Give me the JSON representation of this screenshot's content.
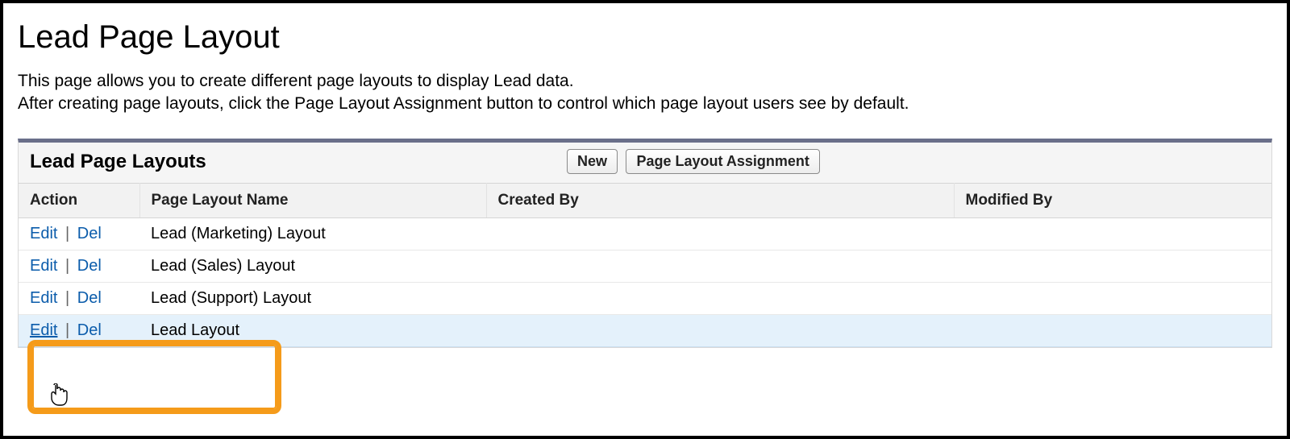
{
  "page": {
    "title": "Lead Page Layout",
    "description_line1": "This page allows you to create different page layouts to display Lead data.",
    "description_line2": "After creating page layouts, click the Page Layout Assignment button to control which page layout users see by default."
  },
  "panel": {
    "title": "Lead Page Layouts",
    "buttons": {
      "new": "New",
      "assignment": "Page Layout Assignment"
    }
  },
  "table": {
    "columns": {
      "action": "Action",
      "name": "Page Layout Name",
      "created_by": "Created By",
      "modified_by": "Modified By"
    },
    "action_labels": {
      "edit": "Edit",
      "del": "Del",
      "sep": "|"
    },
    "rows": [
      {
        "name": "Lead (Marketing) Layout",
        "created_by": "",
        "modified_by": "",
        "hover": false
      },
      {
        "name": "Lead (Sales) Layout",
        "created_by": "",
        "modified_by": "",
        "hover": false
      },
      {
        "name": "Lead (Support) Layout",
        "created_by": "",
        "modified_by": "",
        "hover": false
      },
      {
        "name": "Lead Layout",
        "created_by": "",
        "modified_by": "",
        "hover": true
      }
    ]
  }
}
